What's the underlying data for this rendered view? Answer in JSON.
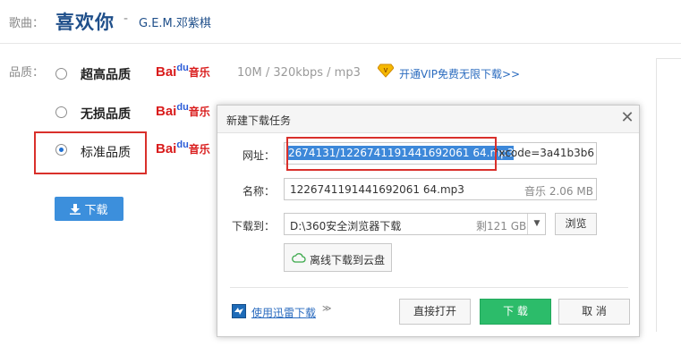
{
  "song": {
    "label": "歌曲：",
    "title": "喜欢你",
    "separator": "-",
    "artist": "G.E.M.邓紫棋"
  },
  "quality": {
    "label": "品质：",
    "options": [
      {
        "name": "超高品质",
        "selected": false
      },
      {
        "name": "无损品质",
        "selected": false
      },
      {
        "name": "标准品质",
        "selected": true
      }
    ],
    "info": "10M / 320kbps / mp3",
    "vip_link": "开通VIP免费无限下载>>"
  },
  "brand": {
    "bai": "Bai",
    "du": "du",
    "music": "音乐"
  },
  "download_button": "下载",
  "dialog": {
    "title": "新建下载任务",
    "url_label": "网址：",
    "url_selected": "2674131/1226741191441692061 64.mp3",
    "url_rest": "?xcode=3a41b3b6",
    "name_label": "名称：",
    "name_value": "1226741191441692061 64.mp3",
    "name_type": "音乐 2.06 MB",
    "path_label": "下载到：",
    "path_value": "D:\\360安全浏览器下载",
    "path_free": "剩121 GB",
    "browse_button": "浏览",
    "cloud_button": "离线下载到云盘",
    "thunder_link": "使用迅雷下载",
    "open_button": "直接打开",
    "download_button": "下 载",
    "cancel_button": "取 消"
  },
  "colors": {
    "accent_blue": "#3c8fdc",
    "title_blue": "#1f4f8a",
    "highlight_red": "#d9302b",
    "download_green": "#2cbc6a"
  }
}
